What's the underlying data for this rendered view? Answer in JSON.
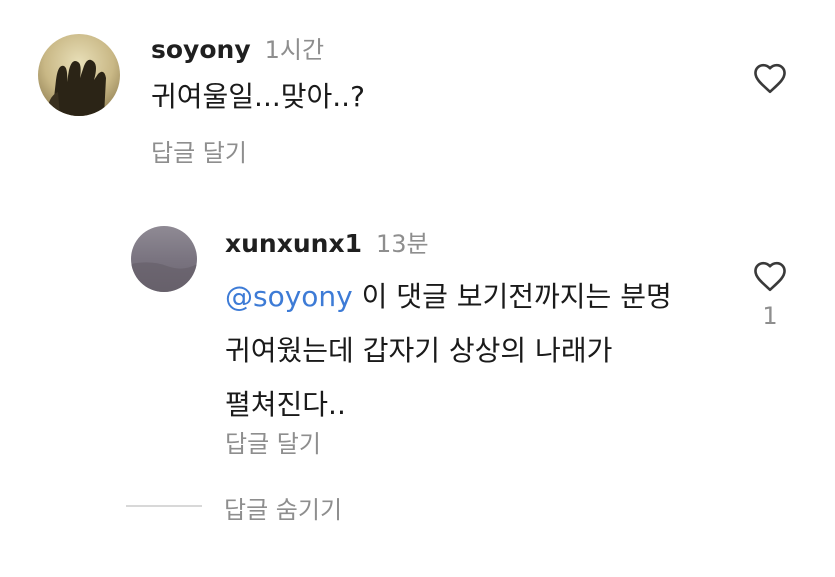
{
  "comments": [
    {
      "username": "soyony",
      "time": "1시간",
      "text_lines": [
        "귀여울일...맞아..?"
      ],
      "reply_label": "답글 달기",
      "like_icon": "heart-outline-icon",
      "like_count": ""
    }
  ],
  "replies": [
    {
      "username": "xunxunx1",
      "time": "13분",
      "mention": "@soyony",
      "text_line1_rest": " 이 댓글 보기전까지는 분명",
      "text_line2": "귀여웠는데 갑자기 상상의 나래가",
      "text_line3": "펼쳐진다..",
      "reply_label": "답글 달기",
      "like_icon": "heart-outline-icon",
      "like_count": "1"
    }
  ],
  "hide_replies_label": "답글 숨기기",
  "colors": {
    "mention": "#3d7bd6",
    "muted": "#8e8e8e"
  }
}
